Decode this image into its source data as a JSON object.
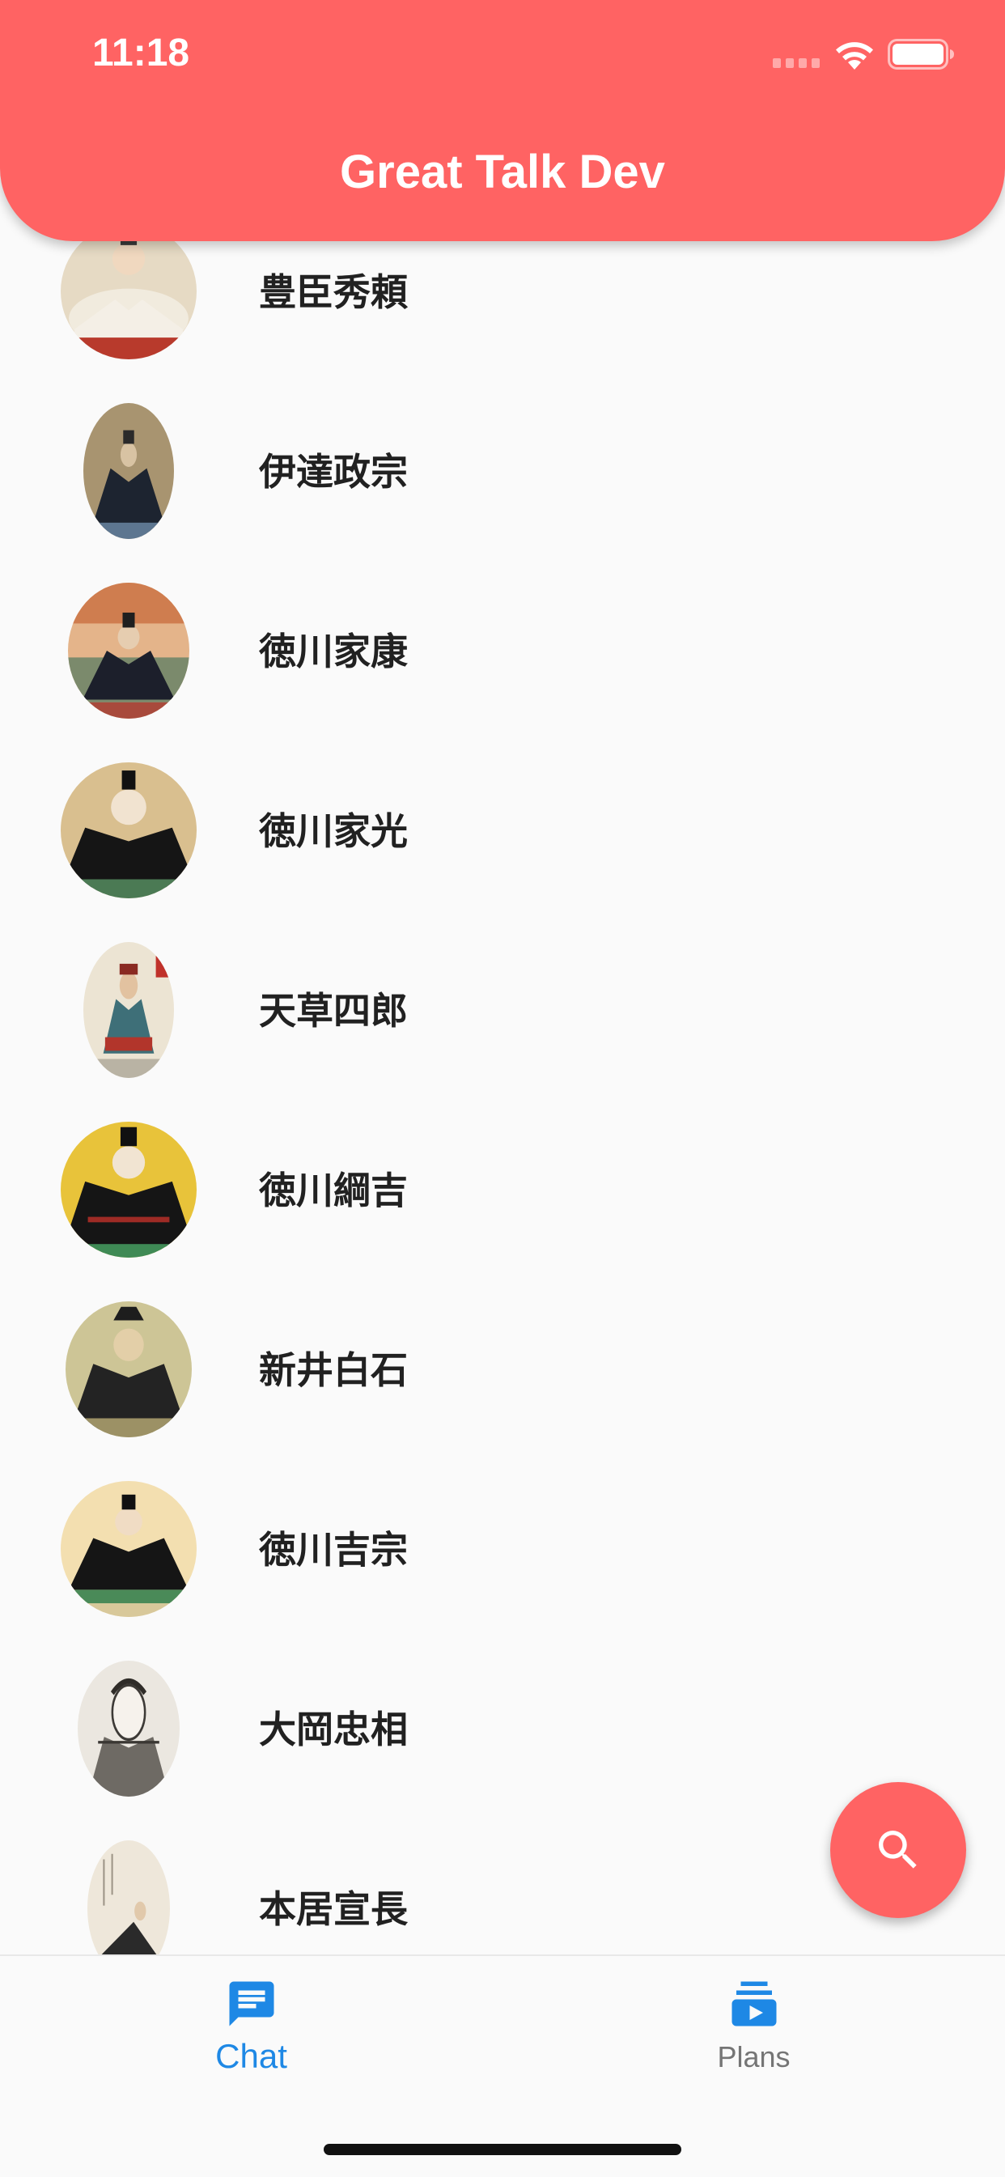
{
  "status_bar": {
    "time": "11:18",
    "icons": [
      "cellular-signal-icon",
      "wifi-icon",
      "battery-icon"
    ]
  },
  "app_bar": {
    "title": "Great Talk Dev",
    "color": "#ff6363"
  },
  "people": [
    {
      "name": "豊臣秀頼",
      "avatar": "portrait-icon"
    },
    {
      "name": "伊達政宗",
      "avatar": "portrait-icon"
    },
    {
      "name": "徳川家康",
      "avatar": "portrait-icon"
    },
    {
      "name": "徳川家光",
      "avatar": "portrait-icon"
    },
    {
      "name": "天草四郎",
      "avatar": "portrait-icon"
    },
    {
      "name": "徳川綱吉",
      "avatar": "portrait-icon"
    },
    {
      "name": "新井白石",
      "avatar": "portrait-icon"
    },
    {
      "name": "徳川吉宗",
      "avatar": "portrait-icon"
    },
    {
      "name": "大岡忠相",
      "avatar": "portrait-icon"
    },
    {
      "name": "本居宣長",
      "avatar": "portrait-icon"
    }
  ],
  "fab": {
    "icon": "search-icon",
    "color": "#ff6363"
  },
  "bottom_nav": {
    "items": [
      {
        "label": "Chat",
        "icon": "chat-icon",
        "active": true,
        "color": "#1e88e5"
      },
      {
        "label": "Plans",
        "icon": "subscriptions-icon",
        "active": false,
        "color": "#1e88e5"
      }
    ]
  }
}
